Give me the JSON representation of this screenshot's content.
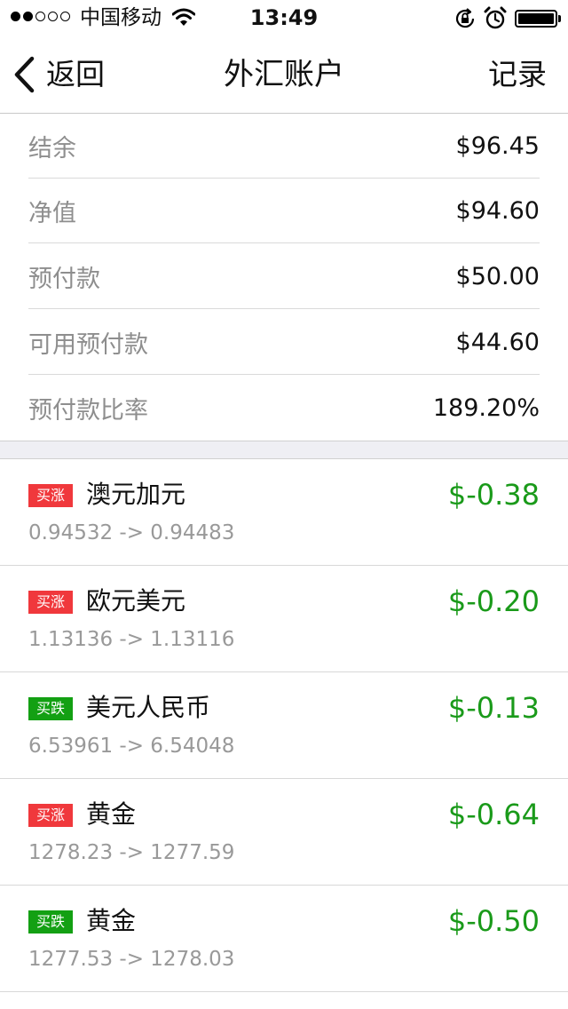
{
  "status_bar": {
    "carrier": "中国移动",
    "time": "13:49",
    "signal_bars_filled": 2,
    "signal_bars_total": 5
  },
  "nav": {
    "back_label": "返回",
    "title": "外汇账户",
    "right_label": "记录"
  },
  "summary": [
    {
      "label": "结余",
      "value": "$96.45"
    },
    {
      "label": "净值",
      "value": "$94.60"
    },
    {
      "label": "预付款",
      "value": "$50.00"
    },
    {
      "label": "可用预付款",
      "value": "$44.60"
    },
    {
      "label": "预付款比率",
      "value": "189.20%"
    }
  ],
  "positions": [
    {
      "badge": "买涨",
      "badge_color": "#f0383c",
      "name": "澳元加元",
      "profit": "$-0.38",
      "prices": "0.94532 -> 0.94483"
    },
    {
      "badge": "买涨",
      "badge_color": "#f0383c",
      "name": "欧元美元",
      "profit": "$-0.20",
      "prices": "1.13136 -> 1.13116"
    },
    {
      "badge": "买跌",
      "badge_color": "#13a013",
      "name": "美元人民币",
      "profit": "$-0.13",
      "prices": "6.53961 -> 6.54048"
    },
    {
      "badge": "买涨",
      "badge_color": "#f0383c",
      "name": "黄金",
      "profit": "$-0.64",
      "prices": "1278.23 -> 1277.59"
    },
    {
      "badge": "买跌",
      "badge_color": "#13a013",
      "name": "黄金",
      "profit": "$-0.50",
      "prices": "1277.53 -> 1278.03"
    }
  ],
  "colors": {
    "profit": "#1a9a1a",
    "label_gray": "#8e8e8e",
    "separator": "#dadada",
    "section_gap": "#efeff4"
  }
}
